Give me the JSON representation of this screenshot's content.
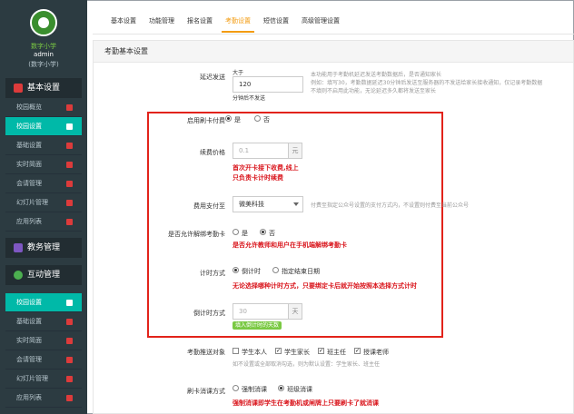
{
  "sidebar": {
    "org_name": "数字小学",
    "user": "admin",
    "user_org": "(数字小学)",
    "section1": "基本设置",
    "group1": [
      "校园概览",
      "校园设置",
      "基础设置",
      "实时简面",
      "会请管理",
      "幻灯片管理",
      "应用列表"
    ],
    "section2": "教务管理",
    "section3": "互动管理",
    "group2": [
      "校园设置",
      "基础设置",
      "实时简面",
      "会请管理",
      "幻灯片管理",
      "应用列表"
    ]
  },
  "tabs": [
    "基本设置",
    "功能管理",
    "报名设置",
    "考勤设置",
    "短信设置",
    "高级管理设置"
  ],
  "panel": {
    "title": "考勤基本设置",
    "delay_label": "延迟发送",
    "delay_prefix": "大于",
    "delay_value": "120",
    "delay_suffix": "分钟后不发送",
    "delay_help1": "本功能用于考勤机延迟发送考勤数据后，是否通知家长",
    "delay_help2": "例如：填写30，考勤数据延迟30分钟后发送至服务器的不发送给家长接收通知，仅记录考勤数据",
    "delay_help3": "不填则不启用此功能，无论延迟多久都将发送至家长",
    "card_fee_label": "启用刷卡付费",
    "yes": "是",
    "no": "否",
    "renew_price_label": "续费价格",
    "renew_price_placeholder": "0.1",
    "unit_yuan": "元",
    "renew_note1": "首次开卡接下收费,线上",
    "renew_note2": "只负责卡计时续费",
    "pay_to_label": "费用支付至",
    "pay_to_value": "微美科技",
    "pay_to_help": "付费至指定公众号设置的支付方式内，不设置则付费至当前公众号",
    "unbind_label": "是否允许解绑考勤卡",
    "unbind_note": "是否允许教师和用户在手机端解绑考勤卡",
    "timing_label": "计时方式",
    "timing_opt1": "倒计时",
    "timing_opt2": "指定结束日期",
    "timing_note": "无论选择哪种计时方式，只要绑定卡后就开始按照本选择方式计时",
    "countdown_label": "倒计时方式",
    "countdown_placeholder": "30",
    "unit_day": "天",
    "countdown_badge": "填入倒计时的天数",
    "push_label": "考勤推送对象",
    "push_opts": [
      "学生本人",
      "学生家长",
      "班主任",
      "授课老师"
    ],
    "push_help": "如不设置或全部取消勾选，则为默认设置：学生家长、班主任",
    "swipe_label": "刷卡消课方式",
    "swipe_opt1": "强制消课",
    "swipe_opt2": "班级消课",
    "swipe_note": "强制消课即学生在考勤机或闸牌上只要刷卡了就消课"
  }
}
